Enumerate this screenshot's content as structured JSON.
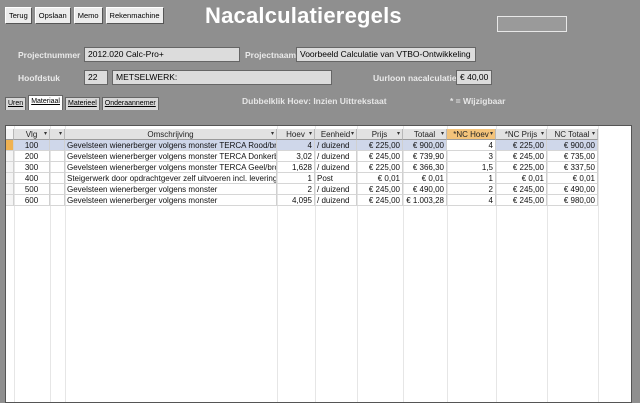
{
  "toolbar": {
    "terug": "Terug",
    "opslaan": "Opslaan",
    "memo": "Memo",
    "rekenmachine": "Rekenmachine"
  },
  "window_title": "Nacalculatieregels",
  "project": {
    "nummer_label": "Projectnummer",
    "nummer_value": "2012.020 Calc-Pro+",
    "naam_label": "Projectnaam",
    "naam_value": "Voorbeeld Calculatie van VTBO-Ontwikkeling",
    "hoofdstuk_label": "Hoofdstuk",
    "hoofdstuk_num": "22",
    "hoofdstuk_value": "METSELWERK:",
    "uurloon_label": "Uurloon nacalculatie",
    "uurloon_value": "€ 40,00"
  },
  "tabs": [
    "Uren",
    "Materiaal",
    "Materieel",
    "Onderaannemer"
  ],
  "hints": {
    "dubbelklik": "Dubbelklik Hoev: Inzien Uittrekstaat",
    "wijziging": "* = Wijzigbaar"
  },
  "table": {
    "headers": [
      "Vlg",
      "Omschrijving",
      "Hoev",
      "Eenheid",
      "Prijs",
      "Totaal",
      "*NC Hoev",
      "*NC Prijs",
      "NC Totaal"
    ],
    "rows": [
      {
        "vlg": "100",
        "oms": "Gevelsteen wienerberger volgens monster TERCA Rood/bruin",
        "hoev": "4",
        "eenheid": "/ duizend",
        "prijs": "€ 225,00",
        "totaal": "€ 900,00",
        "nc_hoev": "4",
        "nc_prijs": "€ 225,00",
        "nc_totaal": "€ 900,00"
      },
      {
        "vlg": "200",
        "oms": "Gevelsteen wienerberger volgens monster TERCA Donkerbrui",
        "hoev": "3,02",
        "eenheid": "/ duizend",
        "prijs": "€ 245,00",
        "totaal": "€ 739,90",
        "nc_hoev": "3",
        "nc_prijs": "€ 245,00",
        "nc_totaal": "€ 735,00"
      },
      {
        "vlg": "300",
        "oms": "Gevelsteen wienerberger volgens monster TERCA Geel/brons",
        "hoev": "1,628",
        "eenheid": "/ duizend",
        "prijs": "€ 225,00",
        "totaal": "€ 366,30",
        "nc_hoev": "1,5",
        "nc_prijs": "€ 225,00",
        "nc_totaal": "€ 337,50"
      },
      {
        "vlg": "400",
        "oms": "Steigerwerk door opdrachtgever zelf uitvoeren incl. levering",
        "hoev": "1",
        "eenheid": "Post",
        "prijs": "€ 0,01",
        "totaal": "€ 0,01",
        "nc_hoev": "1",
        "nc_prijs": "€ 0,01",
        "nc_totaal": "€ 0,01"
      },
      {
        "vlg": "500",
        "oms": "Gevelsteen wienerberger volgens monster",
        "hoev": "2",
        "eenheid": "/ duizend",
        "prijs": "€ 245,00",
        "totaal": "€ 490,00",
        "nc_hoev": "2",
        "nc_prijs": "€ 245,00",
        "nc_totaal": "€ 490,00"
      },
      {
        "vlg": "600",
        "oms": "Gevelsteen wienerberger volgens monster",
        "hoev": "4,095",
        "eenheid": "/ duizend",
        "prijs": "€ 245,00",
        "totaal": "€ 1.003,28",
        "nc_hoev": "4",
        "nc_prijs": "€ 245,00",
        "nc_totaal": "€ 980,00"
      }
    ]
  },
  "colors": {
    "background": "#8f8f8f",
    "selected_header": "#f3c37a",
    "selected_row": "#cfd7ea"
  }
}
